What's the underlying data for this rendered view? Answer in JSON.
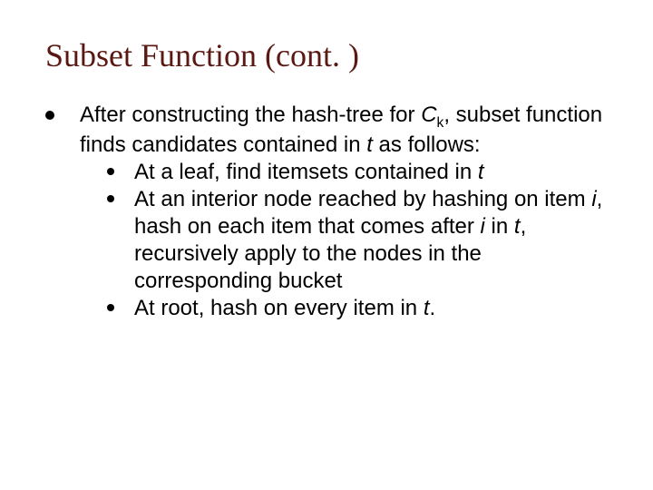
{
  "title": "Subset Function (cont. )",
  "para_pre": "After constructing the hash-tree for ",
  "C": "C",
  "k": "k",
  "para_mid": ", subset function finds candidates contained in ",
  "t1": "t",
  "para_post": " as follows:",
  "sub1_pre": "At a leaf, find itemsets contained in ",
  "sub1_t": "t",
  "sub2_pre": "At an interior node reached by hashing on item ",
  "sub2_i1": "i",
  "sub2_mid1": ", hash on each item that comes after ",
  "sub2_i2": "i",
  "sub2_mid2": " in ",
  "sub2_t": "t",
  "sub2_post": ", recursively apply to the nodes in the corresponding bucket",
  "sub3_pre": "At root, hash on every item in ",
  "sub3_t": "t",
  "sub3_post": "."
}
